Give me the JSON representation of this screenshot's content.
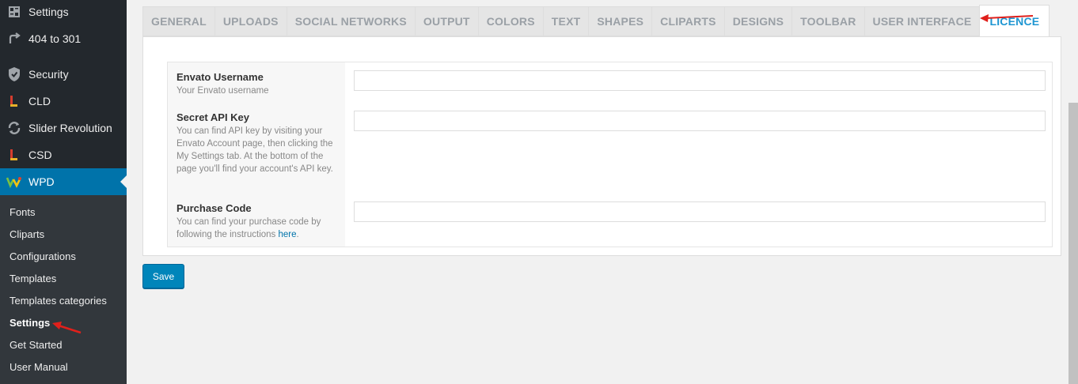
{
  "sidebar": {
    "items": [
      {
        "label": "Settings",
        "icon": "settings-grid-icon"
      },
      {
        "label": "404 to 301",
        "icon": "redirect-arrow-icon"
      },
      {
        "label": "Security",
        "icon": "shield-icon"
      },
      {
        "label": "CLD",
        "icon": "plugin-logo-icon"
      },
      {
        "label": "Slider Revolution",
        "icon": "refresh-icon"
      },
      {
        "label": "CSD",
        "icon": "plugin-logo-icon"
      },
      {
        "label": "WPD",
        "icon": "wpd-logo-icon"
      }
    ],
    "submenu": [
      "Fonts",
      "Cliparts",
      "Configurations",
      "Templates",
      "Templates categories",
      "Settings",
      "Get Started",
      "User Manual"
    ]
  },
  "tabs": [
    "GENERAL",
    "UPLOADS",
    "SOCIAL NETWORKS",
    "OUTPUT",
    "COLORS",
    "TEXT",
    "SHAPES",
    "CLIPARTS",
    "DESIGNS",
    "TOOLBAR",
    "USER INTERFACE",
    "LICENCE"
  ],
  "form": {
    "username": {
      "title": "Envato Username",
      "desc": "Your Envato username",
      "value": ""
    },
    "apikey": {
      "title": "Secret API Key",
      "desc": "You can find API key by visiting your Envato Account page, then clicking the My Settings tab. At the bottom of the page you'll find your account's API key.",
      "value": ""
    },
    "purchase": {
      "title": "Purchase Code",
      "desc_prefix": "You can find your purchase code by following the instructions ",
      "link": "here",
      "desc_suffix": ".",
      "value": ""
    }
  },
  "save_label": "Save",
  "colors": {
    "accent": "#0073aa",
    "active_tab": "#1e96d2",
    "annotation": "#e0201b"
  }
}
